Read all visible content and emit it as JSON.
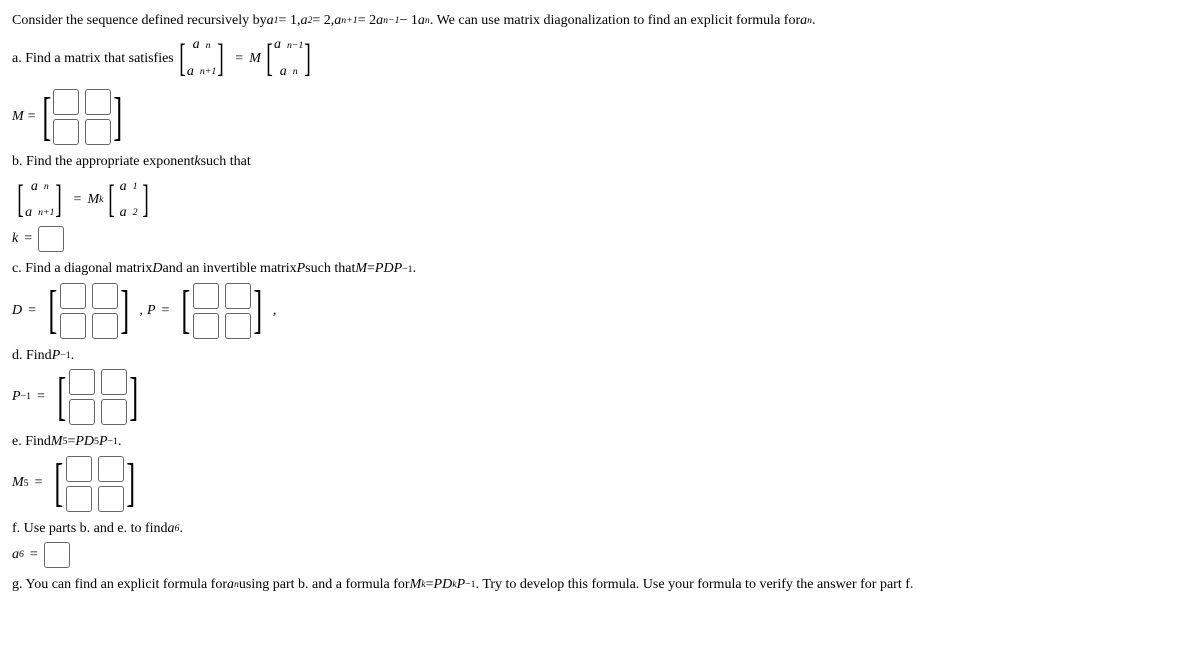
{
  "intro": {
    "prefix": "Consider the sequence defined recursively by ",
    "a1": "a",
    "a1sub": "1",
    "eq1": " = 1, ",
    "a2": "a",
    "a2sub": "2",
    "eq2": " = 2, ",
    "rec_l": "a",
    "rec_lsub": "n+1",
    "eq3": " = 2",
    "rec_m": "a",
    "rec_msub": "n−1",
    "minus": " − 1",
    "rec_r": "a",
    "rec_rsub": "n",
    "suffix1": ". We can use matrix diagonalization to find an explicit formula for ",
    "an": "a",
    "ansub": "n",
    "period": "."
  },
  "partA": {
    "text": "a. Find a matrix that satisfies ",
    "vec1_top_a": "a",
    "vec1_top_sub": "n",
    "vec1_bot_a": "a",
    "vec1_bot_sub": "n+1",
    "M": "M",
    "vec2_top_a": "a",
    "vec2_top_sub": "n−1",
    "vec2_bot_a": "a",
    "vec2_bot_sub": "n",
    "label": "M ="
  },
  "partB": {
    "text": "b. Find the appropriate exponent ",
    "k": "k",
    "text2": " such that",
    "vec1_top_a": "a",
    "vec1_top_sub": "n",
    "vec1_bot_a": "a",
    "vec1_bot_sub": "n+1",
    "Mk": "M",
    "ksup": "k",
    "vec2_top_a": "a",
    "vec2_top_sub": "1",
    "vec2_bot_a": "a",
    "vec2_bot_sub": "2",
    "klabel": "k ="
  },
  "partC": {
    "text1": "c. Find a diagonal matrix ",
    "D": "D",
    "text2": " and an invertible matrix ",
    "P": "P",
    "text3": " such that ",
    "M": "M",
    "eq": " = ",
    "PDP": "PDP",
    "neg1": "−1",
    "period": ".",
    "Dlabel": "D =",
    "Plabel": "P =",
    "comma": ","
  },
  "partD": {
    "text": "d. Find ",
    "P": "P",
    "neg1": "−1",
    "period": ".",
    "label_pre": "P",
    "label_sup": "−1",
    "label_post": " ="
  },
  "partE": {
    "text": "e. Find ",
    "M": "M",
    "five": "5",
    "eq": " = ",
    "PD": "PD",
    "five2": "5",
    "P": "P",
    "neg1": "−1",
    "period": ".",
    "label_pre": "M",
    "label_sup": "5",
    "label_post": " ="
  },
  "partF": {
    "text": "f. Use parts b. and e. to find ",
    "a": "a",
    "six": "6",
    "period": ".",
    "label_pre": "a",
    "label_sub": "6",
    "label_post": " ="
  },
  "partG": {
    "t1": "g. You can find an explicit formula for ",
    "a": "a",
    "n": "n",
    "t2": " using part b. and a formula for ",
    "M": "M",
    "k": "k",
    "eq": " = ",
    "PD": "PD",
    "k2": "k",
    "P": "P",
    "neg1": "−1",
    "t3": ". Try to develop this formula. Use your formula to verify the answer for part f."
  }
}
